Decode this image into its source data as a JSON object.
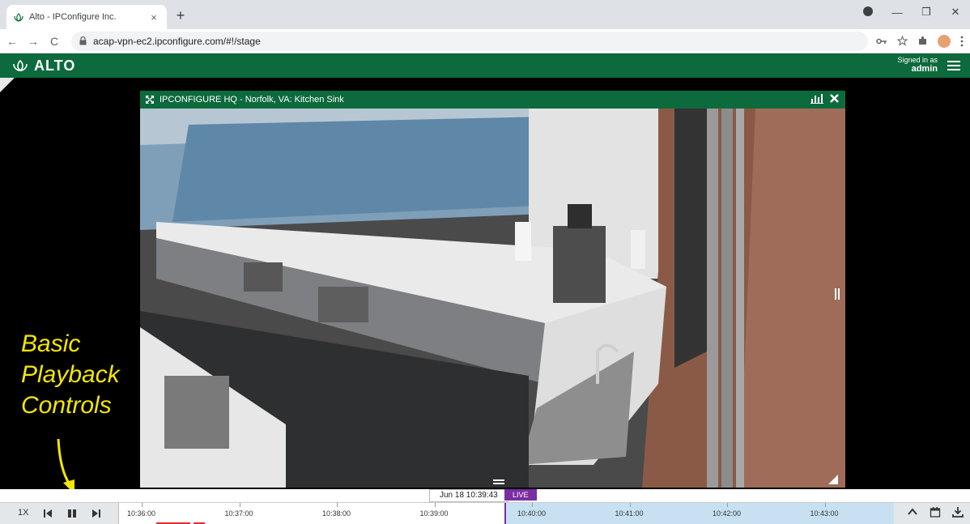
{
  "browser": {
    "tab_title": "Alto - IPConfigure Inc.",
    "tab_close": "×",
    "new_tab": "+",
    "url": "acap-vpn-ec2.ipconfigure.com/#!/stage",
    "window_min": "—",
    "window_restore": "❐",
    "window_close": "✕"
  },
  "app": {
    "brand": "ALTO",
    "signed_in_label": "Signed in as",
    "signed_in_user": "admin"
  },
  "camera": {
    "title": "IPCONFIGURE HQ - Norfolk, VA: Kitchen Sink"
  },
  "annotation": {
    "line1": "Basic",
    "line2": "Playback",
    "line3": "Controls"
  },
  "timeline": {
    "stamp": "Jun 18 10:39:43",
    "live": "LIVE",
    "speed": "1X",
    "ticks": [
      "10:36:00",
      "10:37:00",
      "10:38:00",
      "10:39:00",
      "10:40:00",
      "10:41:00",
      "10:42:00",
      "10:43:00"
    ]
  },
  "colors": {
    "brand_green": "#0c6a3c",
    "live_purple": "#7b2ea2",
    "future_blue": "#c7e1f2",
    "annotation_yellow": "#f4e600"
  }
}
